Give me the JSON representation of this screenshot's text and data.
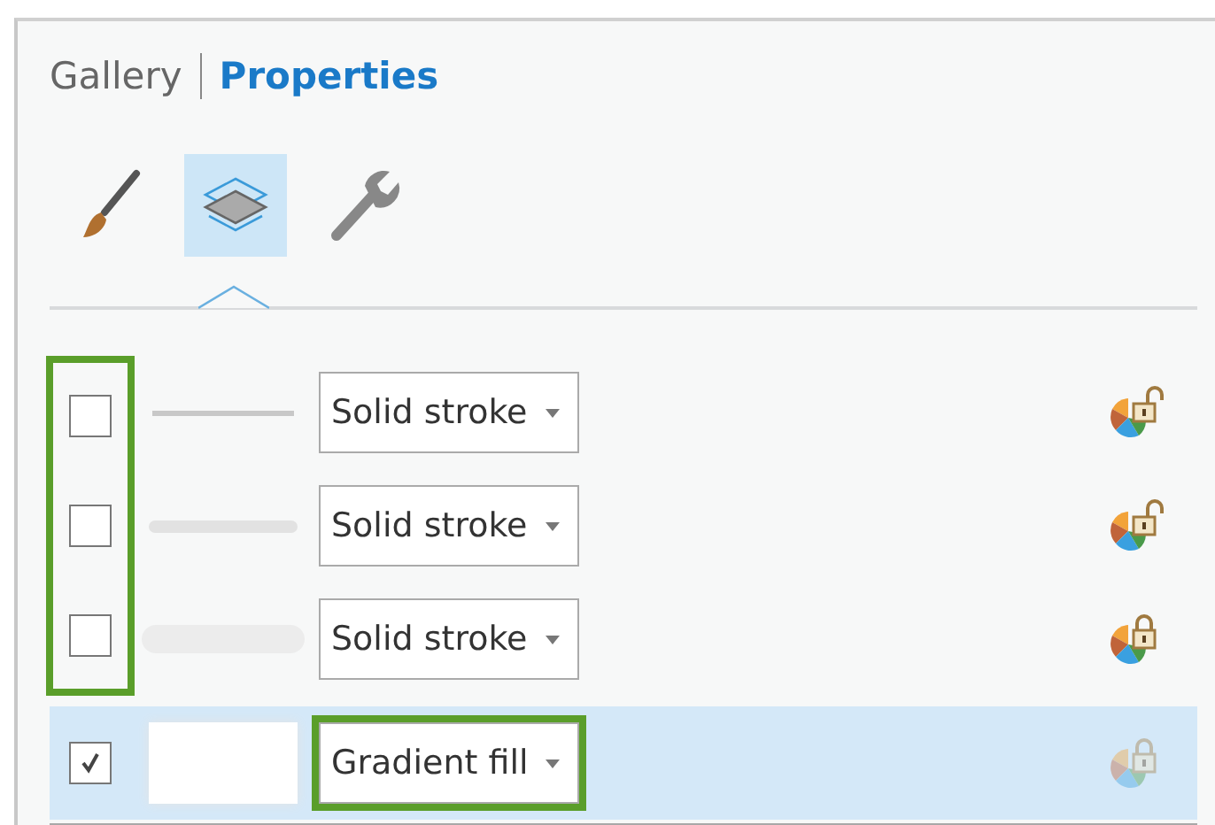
{
  "tabs": [
    {
      "label": "Gallery",
      "selected": false
    },
    {
      "label": "Properties",
      "selected": true
    }
  ],
  "tools": [
    {
      "kind": "brush",
      "selected": false
    },
    {
      "kind": "layers",
      "selected": true
    },
    {
      "kind": "wrench",
      "selected": false
    }
  ],
  "layers": [
    {
      "checked": false,
      "selected": false,
      "checkbox_highlighted": true,
      "kind": "thin-line",
      "type": "Solid stroke",
      "type_highlighted": false,
      "locked": false,
      "disabled": false
    },
    {
      "checked": false,
      "selected": false,
      "checkbox_highlighted": true,
      "kind": "thick-line",
      "type": "Solid stroke",
      "type_highlighted": false,
      "locked": false,
      "disabled": false
    },
    {
      "checked": false,
      "selected": false,
      "checkbox_highlighted": true,
      "kind": "soft-band",
      "type": "Solid stroke",
      "type_highlighted": false,
      "locked": true,
      "disabled": false
    },
    {
      "checked": true,
      "selected": true,
      "checkbox_highlighted": false,
      "kind": "fill-box",
      "type": "Gradient fill",
      "type_highlighted": true,
      "locked": true,
      "disabled": true
    }
  ]
}
